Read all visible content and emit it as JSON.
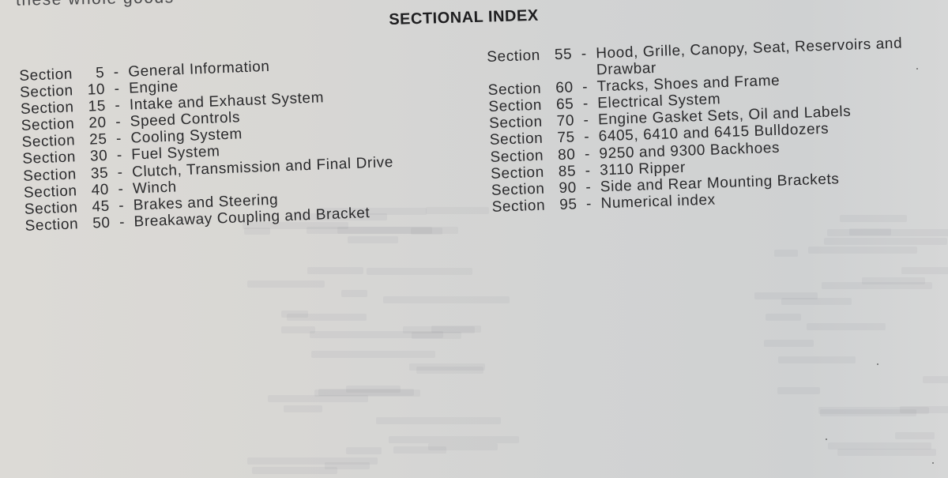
{
  "page": {
    "previous_text_fragment": "these whole goods",
    "heading": "SECTIONAL INDEX",
    "left_column": [
      {
        "label": "Section",
        "number": "5",
        "separator": "-",
        "title": "General Information"
      },
      {
        "label": "Section",
        "number": "10",
        "separator": "-",
        "title": "Engine"
      },
      {
        "label": "Section",
        "number": "15",
        "separator": "-",
        "title": "Intake and Exhaust System"
      },
      {
        "label": "Section",
        "number": "20",
        "separator": "-",
        "title": "Speed Controls"
      },
      {
        "label": "Section",
        "number": "25",
        "separator": "-",
        "title": "Cooling System"
      },
      {
        "label": "Section",
        "number": "30",
        "separator": "-",
        "title": "Fuel System"
      },
      {
        "label": "Section",
        "number": "35",
        "separator": "-",
        "title": "Clutch, Transmission and Final Drive"
      },
      {
        "label": "Section",
        "number": "40",
        "separator": "-",
        "title": "Winch"
      },
      {
        "label": "Section",
        "number": "45",
        "separator": "-",
        "title": "Brakes and Steering"
      },
      {
        "label": "Section",
        "number": "50",
        "separator": "-",
        "title": "Breakaway Coupling and Bracket"
      }
    ],
    "right_column": [
      {
        "label": "Section",
        "number": "55",
        "separator": "-",
        "title": "Hood, Grille, Canopy, Seat, Reservoirs and",
        "continuation": "Drawbar"
      },
      {
        "label": "Section",
        "number": "60",
        "separator": "-",
        "title": "Tracks, Shoes and Frame"
      },
      {
        "label": "Section",
        "number": "65",
        "separator": "-",
        "title": "Electrical System"
      },
      {
        "label": "Section",
        "number": "70",
        "separator": "-",
        "title": "Engine Gasket Sets, Oil and Labels"
      },
      {
        "label": "Section",
        "number": "75",
        "separator": "-",
        "title": "6405, 6410 and 6415 Bulldozers"
      },
      {
        "label": "Section",
        "number": "80",
        "separator": "-",
        "title": "9250 and 9300 Backhoes"
      },
      {
        "label": "Section",
        "number": "85",
        "separator": "-",
        "title": "3110 Ripper"
      },
      {
        "label": "Section",
        "number": "90",
        "separator": "-",
        "title": "Side and Rear Mounting Brackets"
      },
      {
        "label": "Section",
        "number": "95",
        "separator": "-",
        "title": "Numerical index"
      }
    ]
  }
}
